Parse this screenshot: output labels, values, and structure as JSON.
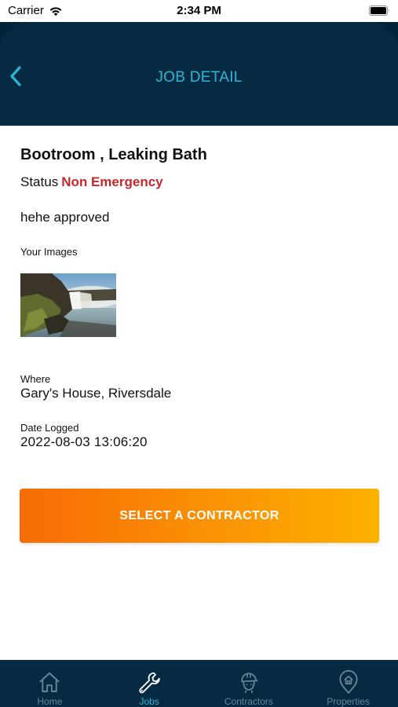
{
  "status_bar": {
    "carrier": "Carrier",
    "time": "2:34 PM"
  },
  "header": {
    "title": "JOB DETAIL",
    "back_icon": "chevron-left-icon"
  },
  "job": {
    "title": "Bootroom , Leaking Bath",
    "status_label": "Status",
    "status_value": "Non Emergency",
    "status_color": "#c4282c",
    "description": "hehe approved",
    "images_label": "Your Images",
    "where_label": "Where",
    "where_value": "Gary's House, Riversdale",
    "date_label": "Date Logged",
    "date_value": "2022-08-03 13:06:20"
  },
  "cta": {
    "label": "SELECT A CONTRACTOR"
  },
  "tabs": [
    {
      "label": "Home",
      "icon": "home-icon",
      "active": false
    },
    {
      "label": "Jobs",
      "icon": "wrench-icon",
      "active": true
    },
    {
      "label": "Contractors",
      "icon": "contractor-icon",
      "active": false
    },
    {
      "label": "Properties",
      "icon": "property-pin-icon",
      "active": false
    }
  ],
  "colors": {
    "header_bg": "#052a42",
    "accent": "#29b7d6",
    "cta_start": "#f76b06",
    "cta_end": "#fdb100",
    "tab_inactive": "#6a8497"
  }
}
